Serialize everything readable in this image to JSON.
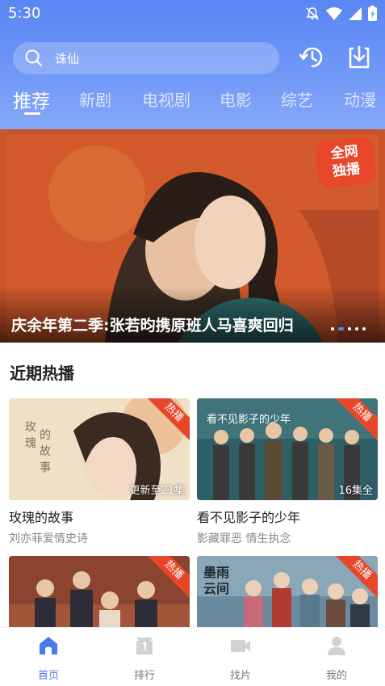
{
  "status_bar": {
    "time": "5:30"
  },
  "search": {
    "text": "诛仙"
  },
  "header_icons": [
    "history-icon",
    "download-icon"
  ],
  "tabs": [
    {
      "label": "推荐",
      "active": true
    },
    {
      "label": "新剧",
      "active": false
    },
    {
      "label": "电视剧",
      "active": false
    },
    {
      "label": "电影",
      "active": false
    },
    {
      "label": "综艺",
      "active": false
    },
    {
      "label": "动漫",
      "active": false
    }
  ],
  "banner": {
    "title": "庆余年第二季:张若昀携原班人马喜爽回归",
    "badge": "全网\n独播",
    "slide_count": 5,
    "active_slide": 1
  },
  "section": {
    "title": "近期热播"
  },
  "cards": [
    {
      "title": "玫瑰的故事",
      "subtitle": "刘亦菲爱情史诗",
      "badge": "热播",
      "episode": "更新至21集"
    },
    {
      "title": "看不见影子的少年",
      "subtitle": "影藏罪恶 情生执念",
      "badge": "热播",
      "episode": "16集全"
    },
    {
      "title": "",
      "subtitle": "",
      "badge": "热播",
      "episode": ""
    },
    {
      "title": "",
      "subtitle": "",
      "badge": "热播",
      "episode": ""
    }
  ],
  "bottom_nav": [
    {
      "label": "首页",
      "icon": "home-icon",
      "active": true
    },
    {
      "label": "排行",
      "icon": "ranking-icon",
      "active": false
    },
    {
      "label": "找片",
      "icon": "video-camera-icon",
      "active": false
    },
    {
      "label": "我的",
      "icon": "profile-icon",
      "active": false
    }
  ],
  "colors": {
    "accent": "#4a78ee",
    "hot": "#e8462b",
    "header_top": "#5a86f4"
  }
}
